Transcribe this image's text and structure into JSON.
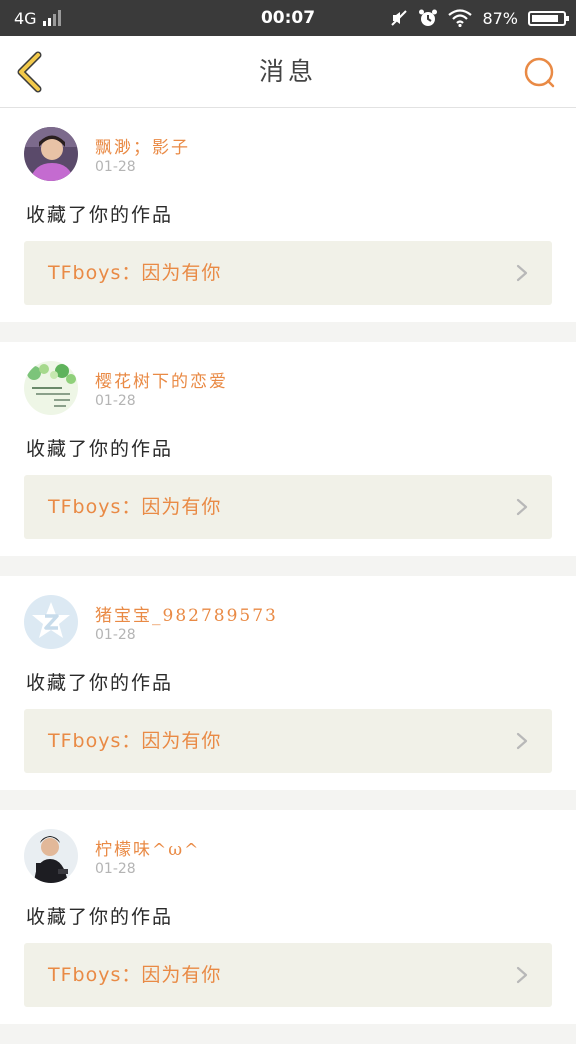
{
  "status_bar": {
    "network": "4G",
    "time": "00:07",
    "battery": "87%",
    "battery_level": 0.87,
    "icons": [
      "mute-icon",
      "alarm-icon",
      "wifi-icon",
      "battery-icon"
    ]
  },
  "header": {
    "title": "消息",
    "back_icon": "chevron-left-icon",
    "search_icon": "search-icon"
  },
  "colors": {
    "accent": "#e98a45",
    "back_icon": "#f2c94a",
    "card_link_bg": "#f1f1e8"
  },
  "messages": [
    {
      "user": "飘渺；影子",
      "date": "01-28",
      "action": "收藏了你的作品",
      "work_title": "TFboys：因为有你",
      "avatar": "photo-avatar"
    },
    {
      "user": "樱花树下的恋爱",
      "date": "01-28",
      "action": "收藏了你的作品",
      "work_title": "TFboys：因为有你",
      "avatar": "green-leaf-avatar"
    },
    {
      "user": "猪宝宝_982789573",
      "date": "01-28",
      "action": "收藏了你的作品",
      "work_title": "TFboys：因为有你",
      "avatar": "qq-default-avatar"
    },
    {
      "user": "柠檬味^ω^",
      "date": "01-28",
      "action": "收藏了你的作品",
      "work_title": "TFboys：因为有你",
      "avatar": "boy-photo-avatar"
    }
  ]
}
